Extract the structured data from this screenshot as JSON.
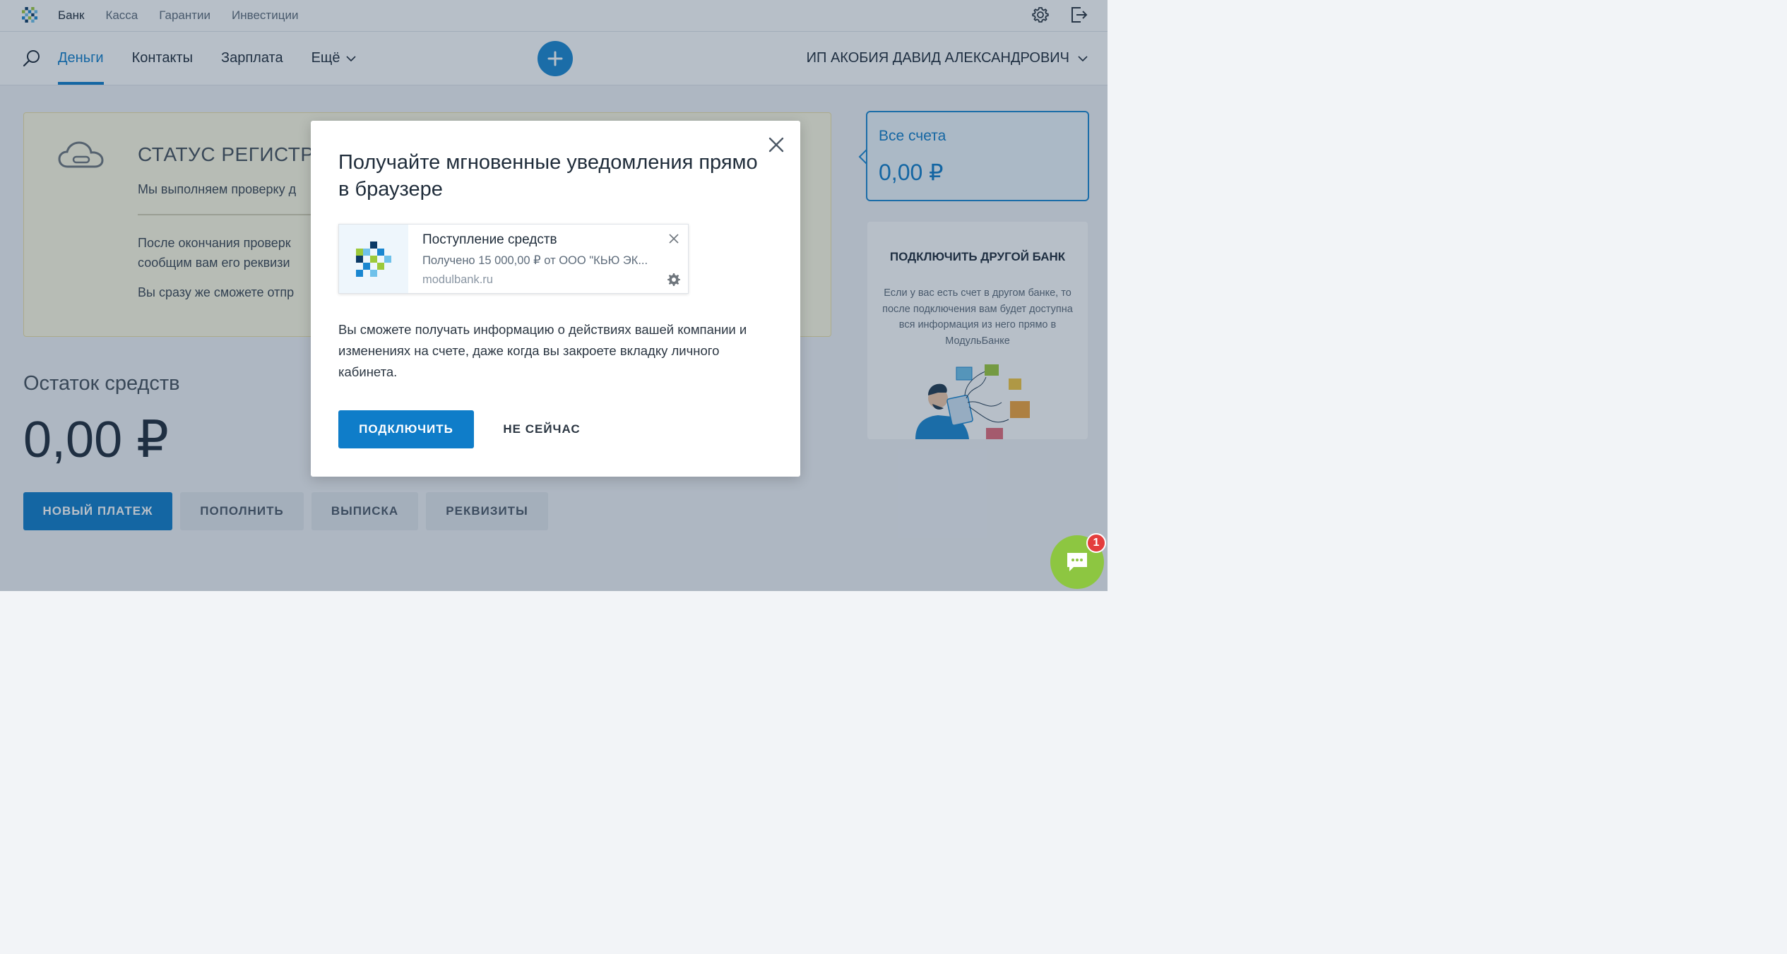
{
  "topbar": {
    "links": [
      "Банк",
      "Касса",
      "Гарантии",
      "Инвестиции"
    ]
  },
  "nav": {
    "items": [
      "Деньги",
      "Контакты",
      "Зарплата",
      "Ещё"
    ],
    "company": "ИП АКОБИЯ ДАВИД АЛЕКСАНДРОВИЧ"
  },
  "status": {
    "title": "СТАТУС РЕГИСТРА",
    "line1": "Мы выполняем проверку д",
    "line2": "После окончания проверк",
    "line3": "сообщим вам его реквизи",
    "line4": "Вы сразу же сможете отпр"
  },
  "balance": {
    "title": "Остаток средств",
    "value": "0,00 ₽"
  },
  "actions": {
    "new_payment": "НОВЫЙ ПЛАТЕЖ",
    "top_up": "ПОПОЛНИТЬ",
    "statement": "ВЫПИСКА",
    "details": "РЕКВИЗИТЫ"
  },
  "accounts": {
    "label": "Все счета",
    "value": "0,00 ₽"
  },
  "other_bank": {
    "title": "ПОДКЛЮЧИТЬ ДРУГОЙ БАНК",
    "desc": "Если у вас есть счет в другом банке, то после подключения вам будет доступна вся информация из него прямо в МодульБанке"
  },
  "modal": {
    "title": "Получайте мгновенные уведомления прямо в браузере",
    "notification": {
      "title": "Поступление средств",
      "body": "Получено 15 000,00 ₽ от ООО \"КЬЮ ЭК...",
      "domain": "modulbank.ru"
    },
    "text": "Вы сможете получать информацию о действиях вашей компании и изменениях на счете, даже когда вы закроете вкладку личного кабинета.",
    "connect": "ПОДКЛЮЧИТЬ",
    "later": "НЕ СЕЙЧАС"
  },
  "chat": {
    "badge": "1"
  },
  "colors": {
    "accent": "#0f7dc9",
    "chat": "#8dc641",
    "badge": "#e43d3d"
  }
}
